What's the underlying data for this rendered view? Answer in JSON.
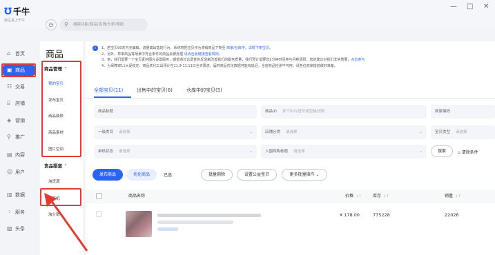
{
  "app": {
    "logo_mark": "\u0001F",
    "logo_mark_glyph": "Ʊ",
    "name": "千牛",
    "tagline": "做生意上千牛"
  },
  "window": {
    "minimize": "—",
    "maximize": "□",
    "close": "✕"
  },
  "search": {
    "placeholder": "搜索功能/商品/店滑/头条/帮助"
  },
  "rail": [
    {
      "label": "首页",
      "icon": "home-icon",
      "glyph": "⌂"
    },
    {
      "label": "商品",
      "icon": "goods-icon",
      "glyph": "▣",
      "active": true
    },
    {
      "label": "交易",
      "icon": "trade-icon",
      "glyph": "☷"
    },
    {
      "label": "店铺",
      "icon": "shop-icon",
      "glyph": "⌸"
    },
    {
      "label": "营销",
      "icon": "marketing-icon",
      "glyph": "◈"
    },
    {
      "label": "推广",
      "icon": "promote-icon",
      "glyph": "⚲"
    },
    {
      "label": "内容",
      "icon": "content-icon",
      "glyph": "▤"
    },
    {
      "label": "用户",
      "icon": "user-icon",
      "glyph": "☺"
    },
    {
      "label": "数据",
      "icon": "data-icon",
      "glyph": "▥"
    },
    {
      "label": "服务",
      "icon": "service-icon",
      "glyph": "⁘"
    },
    {
      "label": "头条",
      "icon": "news-icon",
      "glyph": "▧"
    }
  ],
  "side": {
    "title": "商品",
    "group1": "商品管理",
    "group1_items": [
      "我的宝贝",
      "发布宝贝",
      "商品装修",
      "商品素材",
      "图片空间"
    ],
    "group2": "货品渠道",
    "group2_items": [
      "淘货源",
      "淘商机",
      "淘分销"
    ],
    "caret": "⌃"
  },
  "notice": {
    "lines": [
      [
        "1、若宝贝90天内无编辑、流量或出售的行为，系统将把宝贝作为滞销商品下架至 ",
        "商家/仓库中",
        "，",
        "详情下架宝贝",
        "。"
      ],
      [
        "2、另外，草率商品等场景中符合条件的商品会被处理 ",
        "",
        "",
        "请点击此链接查看规则",
        "。"
      ],
      [
        "3、亲，我们需要一个宝贝素材图片设置服务，期望通过访调查的反馈来改善我们的服务质量，我们预计需要您1分钟时间参与问卷调研，您的建议对我们非常重要，",
        "",
        "",
        "点击参与",
        ""
      ],
      [
        "4、为保障双11大促稳定，商品优化工具预计在11.9-11.11日全天限流，届时商品优化数据可能有延迟，全店商品检测不可用，请各位商家提前做好准备。",
        "",
        "",
        "",
        ""
      ]
    ]
  },
  "tabs": [
    "全部宝贝(11)",
    "出售中的宝贝(6)",
    "仓库中的宝贝(5)"
  ],
  "filters": {
    "row1": [
      {
        "label": "商品标题",
        "placeholder": ""
      },
      {
        "label": "商品ID",
        "placeholder": "多个ID以逗号或空格分隔"
      },
      {
        "label": "商家编码",
        "placeholder": ""
      }
    ],
    "row2": [
      {
        "label": "一级类目",
        "placeholder": "请选择"
      },
      {
        "label": "店铺分类",
        "placeholder": "请选择"
      },
      {
        "label": "宝贝类型",
        "placeholder": "请选择"
      }
    ],
    "row3": [
      {
        "label": "审核状态",
        "placeholder": "请选择"
      },
      {
        "label": "入围导购标题",
        "placeholder": "请选择"
      }
    ],
    "search_button": "搜索",
    "clear_button": "清除条件",
    "clear_glyph": "⌂"
  },
  "actions": {
    "publish": "发布商品",
    "optimize": "优化商品",
    "selected": "已选",
    "batch_delete": "批量删除",
    "public_welfare": "设置公益宝贝",
    "more": "更多批量操作"
  },
  "table": {
    "headers": [
      "商品名称",
      "价格",
      "库存",
      "销量"
    ],
    "sort_glyph": "↓↑",
    "rows": [
      {
        "price": "¥ 178.00",
        "stock": "775228",
        "sales": "22026"
      }
    ]
  },
  "colors": {
    "accent": "#2b63f5",
    "highlight": "#e23b35"
  }
}
